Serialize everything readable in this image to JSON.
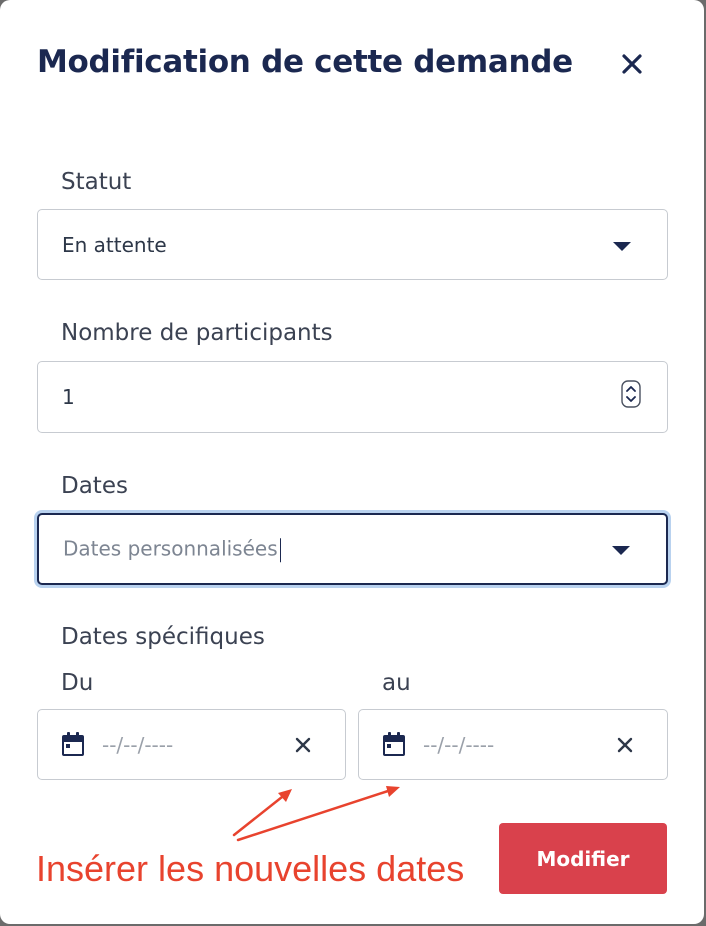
{
  "modal": {
    "title": "Modification de cette demande"
  },
  "form": {
    "status": {
      "label": "Statut",
      "value": "En attente"
    },
    "participants": {
      "label": "Nombre de participants",
      "value": "1"
    },
    "dates": {
      "label": "Dates",
      "value": "Dates personnalisées"
    },
    "specific_dates": {
      "label": "Dates spécifiques",
      "from_label": "Du",
      "to_label": "au",
      "from_placeholder": "--/--/----",
      "to_placeholder": "--/--/----"
    }
  },
  "submit_label": "Modifier",
  "annotation": {
    "text": "Insérer les nouvelles dates",
    "color": "#e8432e"
  },
  "colors": {
    "title": "#1b2850",
    "accent": "#1b2850",
    "submit_bg": "#d9414c",
    "focus_ring": "#b9d2ef"
  },
  "icons": {
    "close": "close-icon",
    "dropdown": "caret-down-icon",
    "spinner": "spinner-icon",
    "calendar": "calendar-icon",
    "clear": "clear-icon"
  }
}
